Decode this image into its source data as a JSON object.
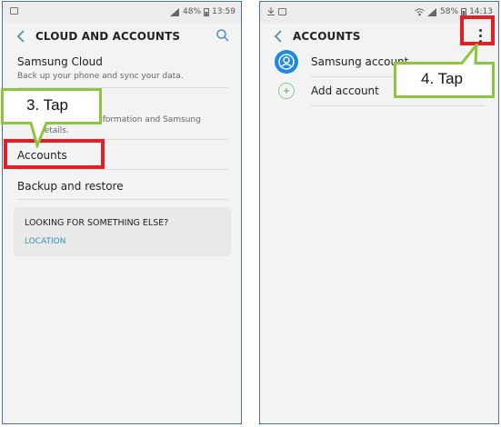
{
  "left_screen": {
    "status": {
      "battery": "48%",
      "time": "13:59"
    },
    "title": "CLOUD AND ACCOUNTS",
    "items": [
      {
        "title": "Samsung Cloud",
        "subtitle": "Back up your phone and sync your data."
      },
      {
        "subtitle_line1": "nformation and Samsung",
        "subtitle_line2": "details."
      },
      {
        "title": "Accounts"
      },
      {
        "title": "Backup and restore"
      }
    ],
    "card": {
      "title": "LOOKING FOR SOMETHING ELSE?",
      "link": "LOCATION"
    },
    "callout": "3. Tap"
  },
  "right_screen": {
    "status": {
      "battery": "58%",
      "time": "14:13"
    },
    "title": "ACCOUNTS",
    "items": [
      {
        "label": "Samsung account"
      },
      {
        "label": "Add account"
      }
    ],
    "callout": "4. Tap"
  },
  "colors": {
    "highlight": "#e31e24",
    "callout_border": "#8cc63f",
    "link": "#3a8fb7",
    "accent_blue": "#1e88e5"
  }
}
